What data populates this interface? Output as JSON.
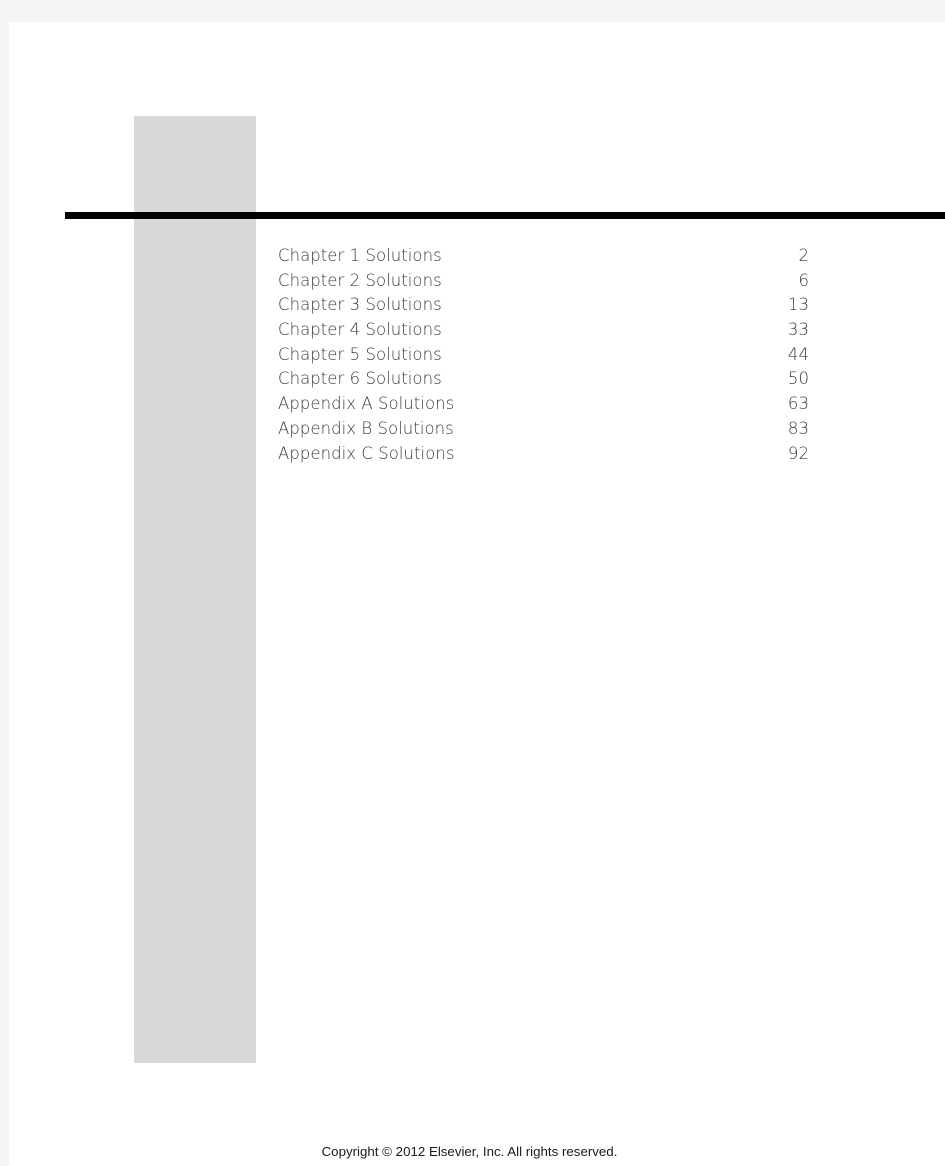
{
  "document": {
    "type": "pdf-page",
    "page_background": "#ffffff",
    "viewer_background": "#f4f4f4"
  },
  "decor": {
    "side_block_color": "#d8d8d8",
    "rule_color": "#000000"
  },
  "toc": {
    "entries": [
      {
        "label": "Chapter 1 Solutions",
        "page": "2"
      },
      {
        "label": "Chapter 2 Solutions",
        "page": "6"
      },
      {
        "label": "Chapter 3 Solutions",
        "page": "13"
      },
      {
        "label": "Chapter 4 Solutions",
        "page": "33"
      },
      {
        "label": "Chapter 5 Solutions",
        "page": "44"
      },
      {
        "label": "Chapter 6 Solutions",
        "page": "50"
      },
      {
        "label": "Appendix A Solutions",
        "page": "63"
      },
      {
        "label": "Appendix B Solutions",
        "page": "83"
      },
      {
        "label": "Appendix C Solutions",
        "page": "92"
      }
    ]
  },
  "footer": {
    "copyright": "Copyright © 2012 Elsevier, Inc. All rights reserved."
  }
}
